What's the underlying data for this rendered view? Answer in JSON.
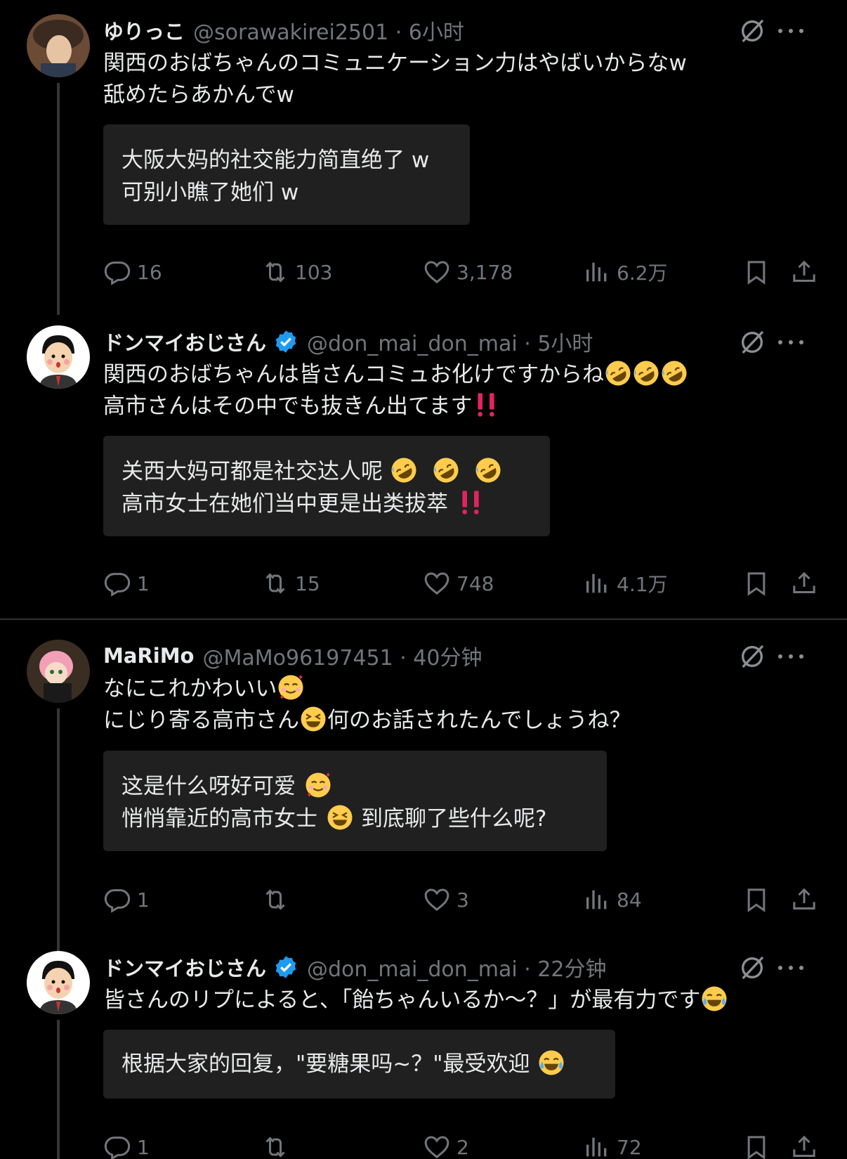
{
  "tweets": [
    {
      "name": "ゆりっこ",
      "handle": "@sorawakirei2501 · 6小时",
      "verified": false,
      "text_line1": "関西のおばちゃんのコミュニケーション力はやばいからなw",
      "text_line2": "舐めたらあかんでw",
      "translation_line1": "大阪大妈的社交能力简直绝了 w",
      "translation_line2": "可别小瞧了她们 w",
      "replies": "16",
      "retweets": "103",
      "likes": "3,178",
      "views": "6.2万"
    },
    {
      "name": "ドンマイおじさん",
      "handle": "@don_mai_don_mai · 5小时",
      "verified": true,
      "text_line1": "関西のおばちゃんは皆さんコミュお化けですからね",
      "text_line2": "高市さんはその中でも抜きん出てます",
      "translation_line1": "关西大妈可都是社交达人呢",
      "translation_line2": "高市女士在她们当中更是出类拔萃",
      "replies": "1",
      "retweets": "15",
      "likes": "748",
      "views": "4.1万"
    },
    {
      "name": "MaRiMo",
      "handle": "@MaMo96197451 · 40分钟",
      "verified": false,
      "text_line1": "なにこれかわいい",
      "text_line2a": "にじり寄る高市さん",
      "text_line2b": "何のお話されたんでしょうね？",
      "translation_line1": "这是什么呀好可爱",
      "translation_line2a": "悄悄靠近的高市女士",
      "translation_line2b": "到底聊了些什么呢?",
      "replies": "1",
      "retweets": "",
      "likes": "3",
      "views": "84"
    },
    {
      "name": "ドンマイおじさん",
      "handle": "@don_mai_don_mai · 22分钟",
      "verified": true,
      "text_line1": "皆さんのリプによると、「飴ちゃんいるか〜？」が最有力です",
      "translation_line1": "根据大家的回复，\"要糖果吗~？\"最受欢迎",
      "replies": "1",
      "retweets": "",
      "likes": "2",
      "views": "72"
    }
  ],
  "colors": {
    "background": "#000000",
    "text": "#e7e9ea",
    "muted": "#71767b",
    "translation_bg": "#202020",
    "verified": "#1d9bf0",
    "exclaim": "#e0245e"
  }
}
